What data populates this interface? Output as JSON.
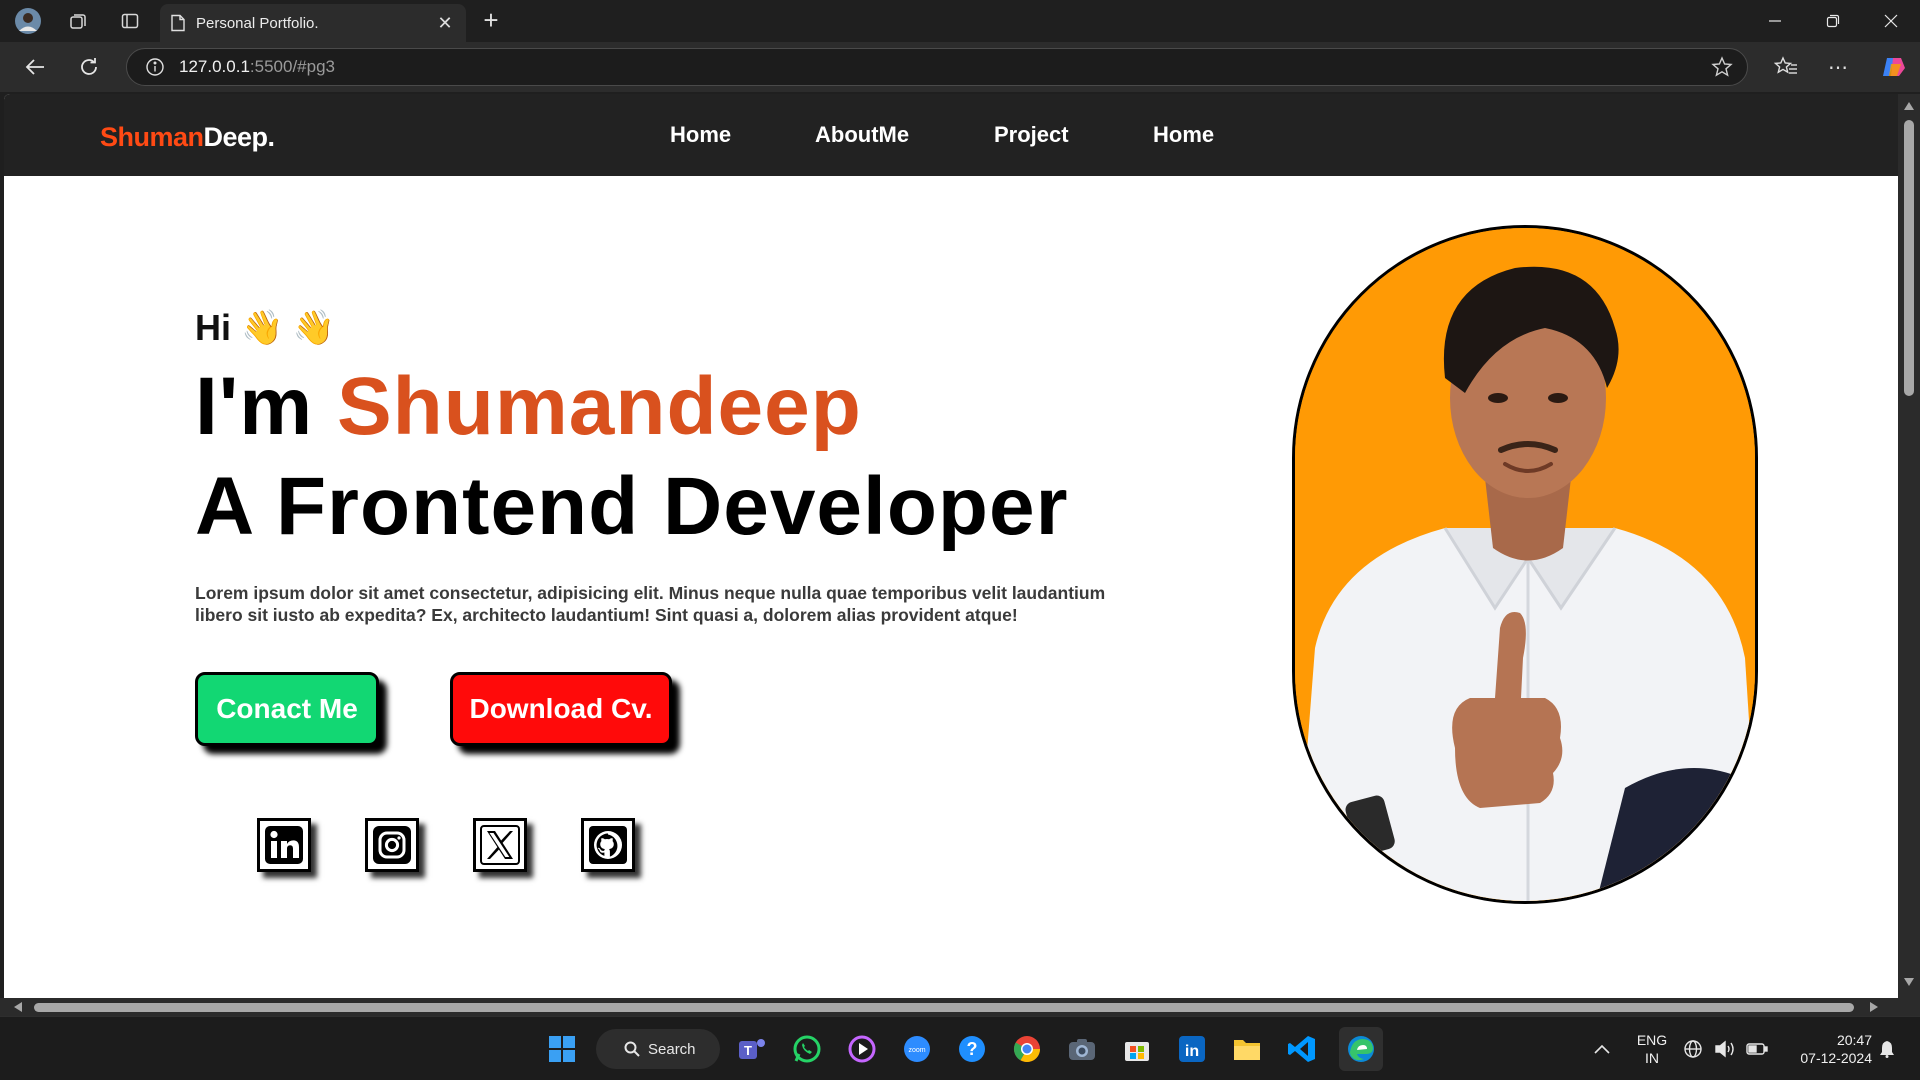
{
  "browser": {
    "tab_title": "Personal Portfolio.",
    "url_host": "127.0.0.1",
    "url_path": ":5500/#pg3"
  },
  "site": {
    "logo_part1": "Shuman",
    "logo_part2": "Deep.",
    "nav": [
      "Home",
      "AboutMe",
      "Project",
      "Home"
    ],
    "greeting": "Hi",
    "greeting_emoji": "👋 👋",
    "intro_prefix": "I'm ",
    "intro_name": "Shumandeep",
    "role": "A Frontend Developer",
    "bio": "Lorem ipsum dolor sit amet consectetur, adipisicing elit. Minus neque nulla quae temporibus velit laudantium libero sit iusto ab expedita? Ex, architecto laudantium! Sint quasi a, dolorem alias provident atque!",
    "contact_button": "Conact Me",
    "download_button": "Download Cv.",
    "socials": [
      "linkedin-icon",
      "instagram-icon",
      "x-icon",
      "github-icon"
    ],
    "accent_color": "#d9511e",
    "contact_color": "#12d773",
    "download_color": "#ff0a0a",
    "photo_bg": "#ff9a05"
  },
  "taskbar": {
    "search_label": "Search",
    "lang_line1": "ENG",
    "lang_line2": "IN",
    "time": "20:47",
    "date": "07-12-2024"
  }
}
